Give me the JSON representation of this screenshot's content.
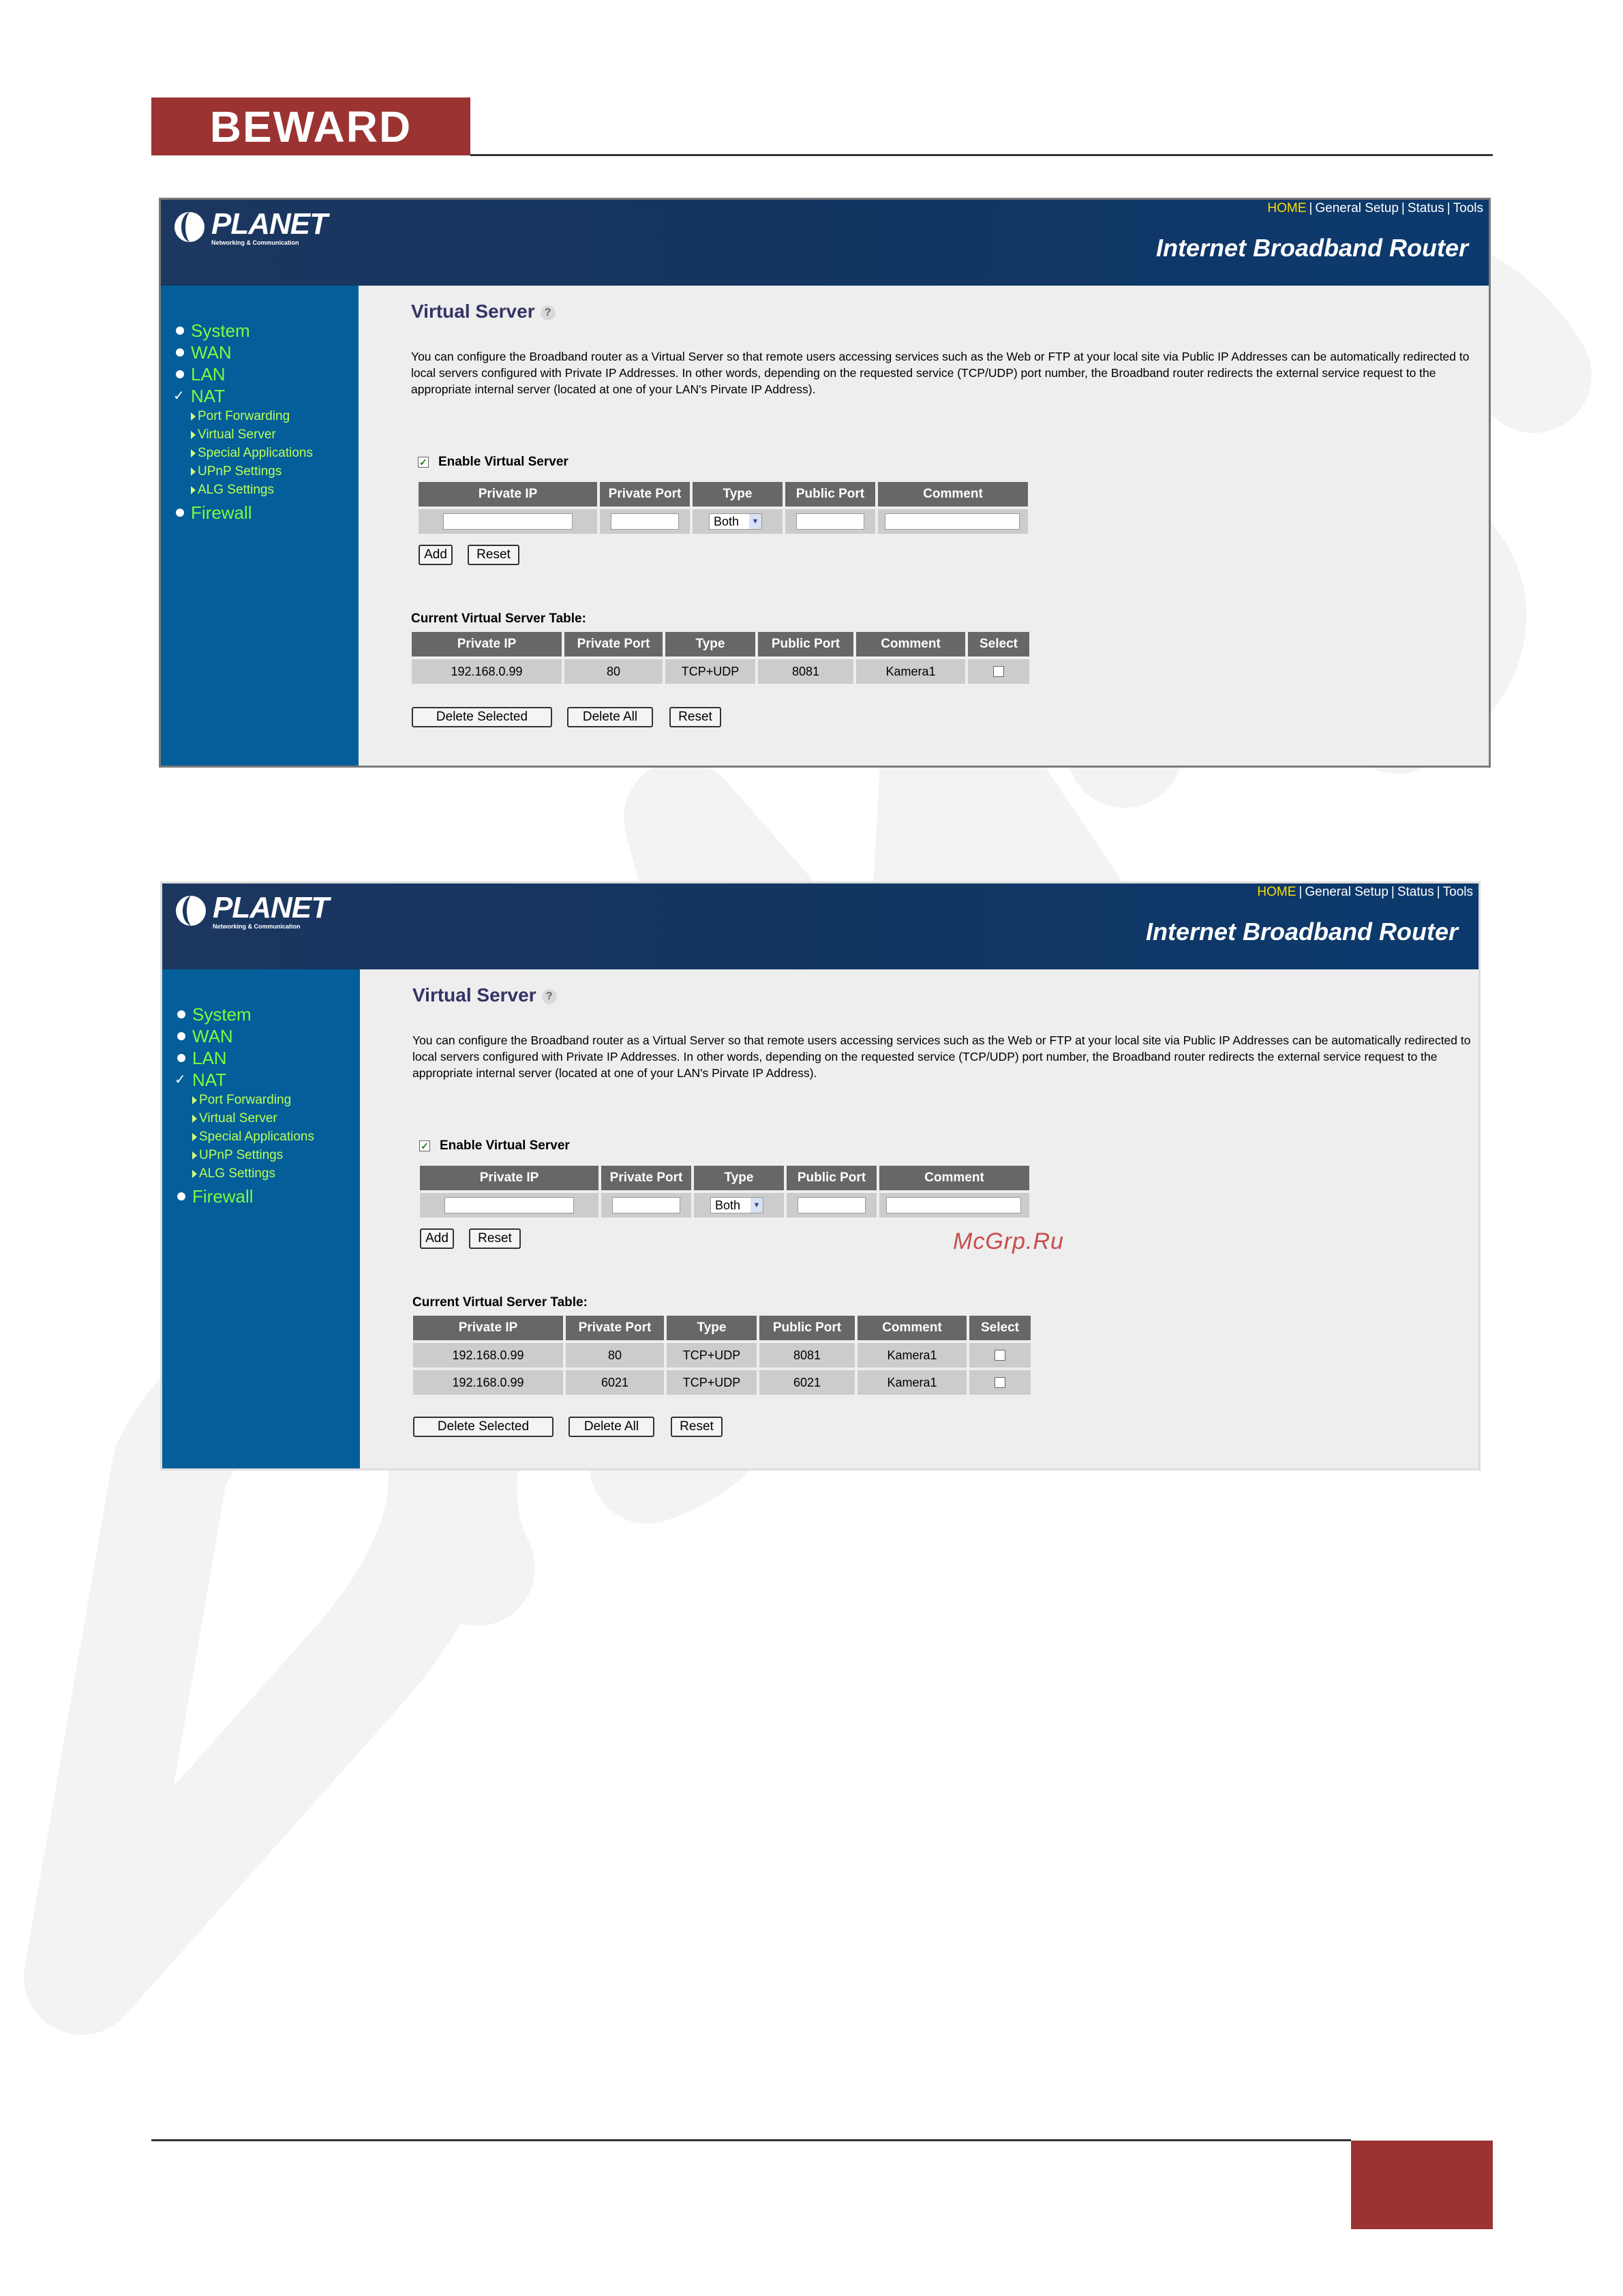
{
  "brand": {
    "name": "BEWARD",
    "color": "#9a3332"
  },
  "router": {
    "logo": "PLANET",
    "logo_tagline": "Networking & Communication",
    "title": "Internet Broadband Router",
    "top_links": [
      "HOME",
      "General Setup",
      "Status",
      "Tools"
    ],
    "sidebar": {
      "main": [
        "System",
        "WAN",
        "LAN",
        "NAT",
        "Firewall"
      ],
      "sub": [
        "Port Forwarding",
        "Virtual Server",
        "Special Applications",
        "UPnP Settings",
        "ALG Settings"
      ]
    },
    "page_title": "Virtual Server",
    "description": "You can configure the Broadband router as a Virtual Server so that remote users accessing services such as the Web or FTP at your local site via Public IP Addresses can be automatically redirected to local servers configured with Private IP Addresses. In other words, depending on the requested service (TCP/UDP) port number, the Broadband router redirects the external service request to the appropriate internal server (located at one of your LAN's Pirvate IP Address).",
    "enable_label": "Enable Virtual Server",
    "input_headers": [
      "Private IP",
      "Private Port",
      "Type",
      "Public Port",
      "Comment"
    ],
    "type_value": "Both",
    "add_button": "Add",
    "reset_button": "Reset",
    "table_caption": "Current Virtual Server Table:",
    "table_headers": [
      "Private IP",
      "Private Port",
      "Type",
      "Public Port",
      "Comment",
      "Select"
    ],
    "delete_selected": "Delete Selected",
    "delete_all": "Delete All"
  },
  "screens": [
    {
      "rows": [
        [
          "192.168.0.99",
          "80",
          "TCP+UDP",
          "8081",
          "Kamera1"
        ]
      ]
    },
    {
      "rows": [
        [
          "192.168.0.99",
          "80",
          "TCP+UDP",
          "8081",
          "Kamera1"
        ],
        [
          "192.168.0.99",
          "6021",
          "TCP+UDP",
          "6021",
          "Kamera1"
        ]
      ]
    }
  ],
  "overlay_text": "McGrp.Ru"
}
